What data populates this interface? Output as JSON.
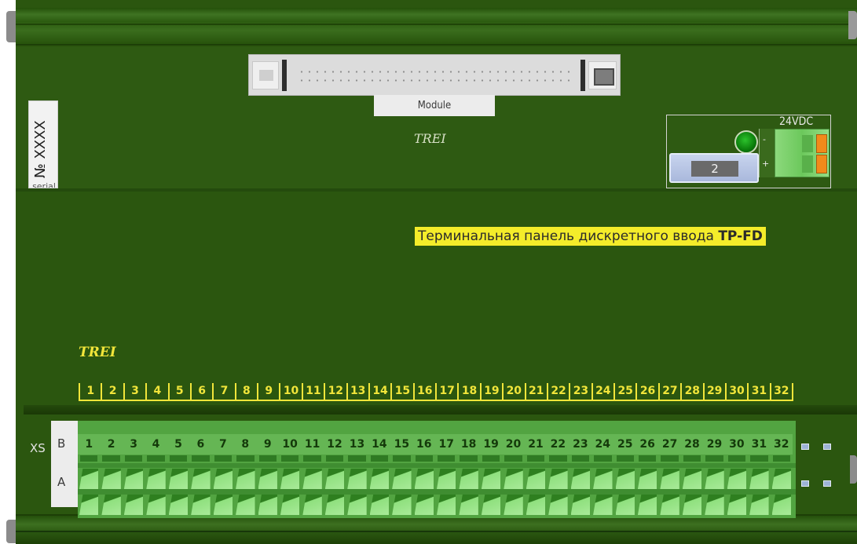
{
  "connector": {
    "label": "Module"
  },
  "brand": {
    "top": "TREI",
    "middle": "TREI"
  },
  "serial": {
    "number": "№ XXXX",
    "label": "serial"
  },
  "power": {
    "voltage": "24VDC",
    "minus": "-",
    "plus": "+",
    "fuse": "2"
  },
  "title": {
    "text": "Терминальная панель дискретного ввода ",
    "model": "TP-FD"
  },
  "silkscreen": [
    "1",
    "2",
    "3",
    "4",
    "5",
    "6",
    "7",
    "8",
    "9",
    "10",
    "11",
    "12",
    "13",
    "14",
    "15",
    "16",
    "17",
    "18",
    "19",
    "20",
    "21",
    "22",
    "23",
    "24",
    "25",
    "26",
    "27",
    "28",
    "29",
    "30",
    "31",
    "32"
  ],
  "terminal": {
    "designator": "XS",
    "row_b": "B",
    "row_a": "A",
    "numbers": [
      "1",
      "2",
      "3",
      "4",
      "5",
      "6",
      "7",
      "8",
      "9",
      "10",
      "11",
      "12",
      "13",
      "14",
      "15",
      "16",
      "17",
      "18",
      "19",
      "20",
      "21",
      "22",
      "23",
      "24",
      "25",
      "26",
      "27",
      "28",
      "29",
      "30",
      "31",
      "32"
    ]
  },
  "colors": {
    "board": "#2b560f",
    "silk": "#f1e53a",
    "terminal": "#52a441",
    "title_bg": "#f4ec2a"
  }
}
